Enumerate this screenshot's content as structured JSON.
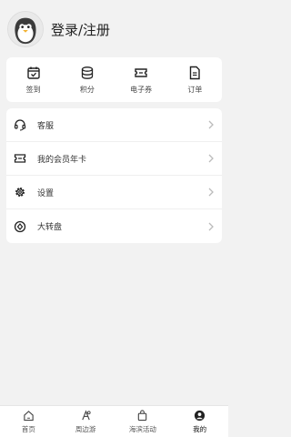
{
  "header": {
    "login_label": "登录/注册",
    "avatar_icon": "penguin-avatar-icon"
  },
  "quick_actions": [
    {
      "label": "签到",
      "icon": "calendar-check-icon"
    },
    {
      "label": "积分",
      "icon": "coin-stack-icon"
    },
    {
      "label": "电子券",
      "icon": "ticket-icon"
    },
    {
      "label": "订单",
      "icon": "document-icon"
    }
  ],
  "menu": [
    {
      "label": "客服",
      "icon": "headset-icon"
    },
    {
      "label": "我的会员年卡",
      "icon": "member-card-icon"
    },
    {
      "label": "设置",
      "icon": "gear-icon"
    },
    {
      "label": "大转盘",
      "icon": "wheel-icon"
    }
  ],
  "tabbar": [
    {
      "label": "首页",
      "icon": "home-icon"
    },
    {
      "label": "周边游",
      "icon": "tour-icon"
    },
    {
      "label": "海滨活动",
      "icon": "bag-icon"
    },
    {
      "label": "我的",
      "icon": "profile-icon",
      "active": true
    }
  ]
}
